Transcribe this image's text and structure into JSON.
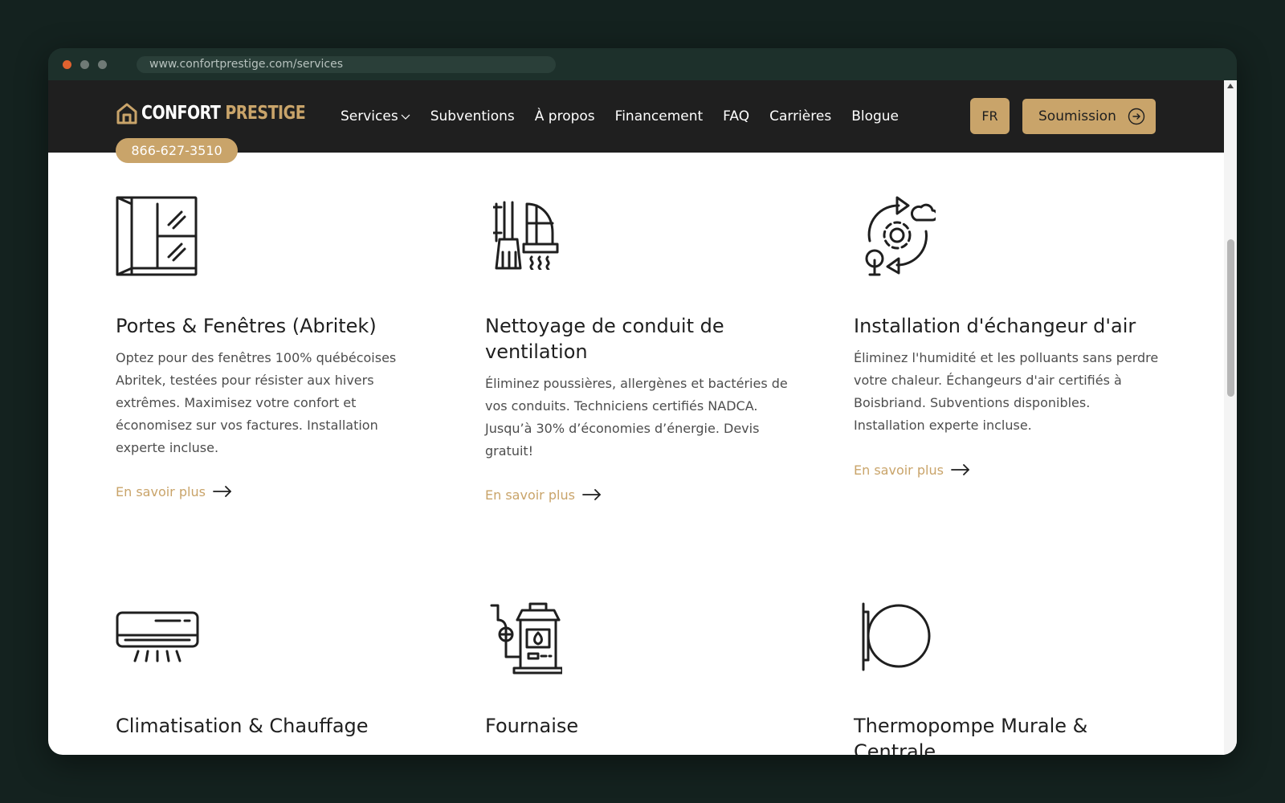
{
  "browser": {
    "url": "www.confortprestige.com/services"
  },
  "nav": {
    "logo": {
      "word1": "CONFORT",
      "word2": "PRESTIGE"
    },
    "menu": [
      "Services",
      "Subventions",
      "À propos",
      "Financement",
      "FAQ",
      "Carrières",
      "Blogue"
    ],
    "language": "FR",
    "cta_label": "Soumission",
    "phone": "866-627-3510"
  },
  "services": [
    {
      "title": "Portes & Fenêtres (Abritek)",
      "desc": "Optez pour des fenêtres 100% québécoises Abritek, testées pour résister aux hivers extrêmes. Maximisez votre confort et économisez sur vos factures. Installation experte incluse.",
      "link": "En savoir plus",
      "icon": "window-icon"
    },
    {
      "title": "Nettoyage de conduit de ventilation",
      "desc": "Éliminez poussières, allergènes et bactéries de vos conduits. Techniciens certifiés NADCA. Jusqu’à 30% d’économies d’énergie. Devis gratuit!",
      "link": "En savoir plus",
      "icon": "duct-cleaning-icon"
    },
    {
      "title": "Installation d'échangeur d'air",
      "desc": "Éliminez l'humidité et les polluants sans perdre votre chaleur. Échangeurs d'air certifiés à Boisbriand. Subventions disponibles. Installation experte incluse.",
      "link": "En savoir plus",
      "icon": "air-exchanger-icon"
    },
    {
      "title": "Climatisation & Chauffage",
      "icon": "air-conditioner-icon"
    },
    {
      "title": "Fournaise",
      "icon": "furnace-icon"
    },
    {
      "title": "Thermopompe Murale & Centrale",
      "icon": "heat-pump-icon"
    }
  ],
  "colors": {
    "accent": "#c9a46a",
    "nav_bg": "#1f1f1f",
    "frame_bg": "#14221f"
  }
}
